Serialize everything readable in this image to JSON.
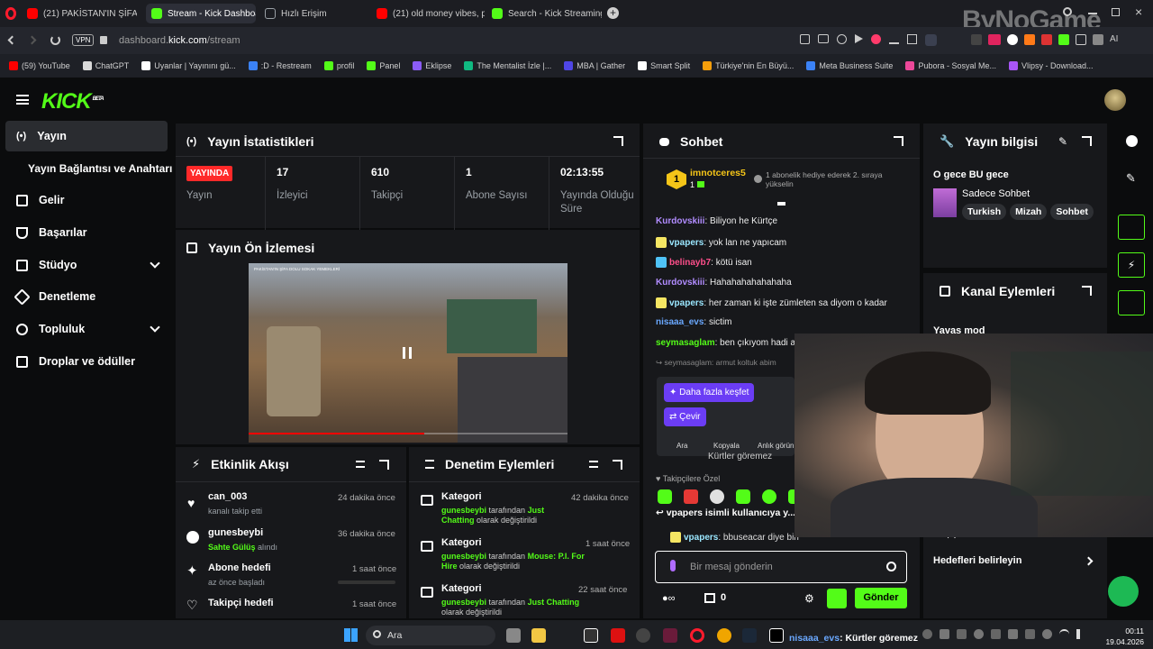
{
  "browser": {
    "tabs": [
      {
        "label": "(21) PAKİSTAN'IN ŞİFA DO",
        "color": "#ff0000",
        "active": false
      },
      {
        "label": "Stream - Kick Dashboard",
        "color": "#53fc18",
        "active": true
      },
      {
        "label": "Hızlı Erişim",
        "color": "#9aa0a6",
        "active": false
      },
      {
        "label": "(21) old money vibes, play",
        "color": "#ff0000",
        "active": false
      },
      {
        "label": "Search - Kick Streaming",
        "color": "#53fc18",
        "active": false
      }
    ],
    "vpn": "VPN",
    "url_prefix": "dashboard.",
    "url_domain": "kick.com",
    "url_path": "/stream",
    "bookmarks": [
      {
        "label": "(59) YouTube",
        "color": "#ff0000"
      },
      {
        "label": "ChatGPT",
        "color": "#d9d9d9"
      },
      {
        "label": "Uyanlar | Yayınını gü...",
        "color": "#ffffff"
      },
      {
        "label": ":D - Restream",
        "color": "#3b82f6"
      },
      {
        "label": "profil",
        "color": "#53fc18"
      },
      {
        "label": "Panel",
        "color": "#53fc18"
      },
      {
        "label": "Eklipse",
        "color": "#8b5cf6"
      },
      {
        "label": "The Mentalist İzle |...",
        "color": "#10b981"
      },
      {
        "label": "MBA | Gather",
        "color": "#4f46e5"
      },
      {
        "label": "Smart Split",
        "color": "#ffffff"
      },
      {
        "label": "Türkiye'nin En Büyü...",
        "color": "#f59e0b"
      },
      {
        "label": "Meta Business Suite",
        "color": "#3b82f6"
      },
      {
        "label": "Pubora - Sosyal Me...",
        "color": "#ec4899"
      },
      {
        "label": "Vlipsy - Download...",
        "color": "#a855f7"
      }
    ],
    "watermark": "ByNoGame"
  },
  "kick": {
    "logo": "KICK",
    "logo_sup": "BETA",
    "accent": "#53fc18"
  },
  "sidebar": {
    "items": [
      {
        "label": "Yayın",
        "active": true
      },
      {
        "label": "Yayın Bağlantısı ve Anahtarı"
      },
      {
        "label": "Gelir"
      },
      {
        "label": "Başarılar"
      },
      {
        "label": "Stüdyo",
        "chevron": true
      },
      {
        "label": "Denetleme"
      },
      {
        "label": "Topluluk",
        "chevron": true
      },
      {
        "label": "Droplar ve ödüller"
      }
    ]
  },
  "stats": {
    "title": "Yayın İstatistikleri",
    "live_badge": "YAYINDA",
    "items": [
      {
        "value": "",
        "label": "Yayın"
      },
      {
        "value": "17",
        "label": "İzleyici"
      },
      {
        "value": "610",
        "label": "Takipçi"
      },
      {
        "value": "1",
        "label": "Abone Sayısı"
      },
      {
        "value": "02:13:55",
        "label": "Yayında Olduğu Süre"
      }
    ]
  },
  "preview": {
    "title": "Yayın Ön İzlemesi",
    "caption": "PAKİSTAN'IN ŞİFA DOLU SOKAK YEMEKLERİ"
  },
  "activity": {
    "title": "Etkinlik Akışı",
    "items": [
      {
        "name": "can_003",
        "sub": "kanalı takip etti",
        "time": "24 dakika önce"
      },
      {
        "name": "gunesbeybi",
        "sub_hl": "Sahte Gülüş",
        "sub": "alındı",
        "time": "36 dakika önce"
      },
      {
        "name": "Abone hedefi",
        "sub": "az önce başladı",
        "time": "1 saat önce"
      },
      {
        "name": "Takipçi hedefi",
        "sub": "",
        "time": "1 saat önce"
      }
    ]
  },
  "moderation": {
    "title": "Denetim Eylemleri",
    "items": [
      {
        "name": "Kategori",
        "user": "gunesbeybi",
        "mid": "tarafından",
        "value": "Just Chatting",
        "end": "olarak değiştirildi",
        "time": "42 dakika önce"
      },
      {
        "name": "Kategori",
        "user": "gunesbeybi",
        "mid": "tarafından",
        "value": "Mouse: P.I. For Hire",
        "end": "olarak değiştirildi",
        "time": "1 saat önce"
      },
      {
        "name": "Kategori",
        "user": "gunesbeybi",
        "mid": "tarafından",
        "value": "Just Chatting",
        "end": "olarak değiştirildi",
        "time": "22 saat önce"
      }
    ]
  },
  "chat": {
    "title": "Sohbet",
    "pinned_user": "imnotceres5",
    "pinned_count": "1",
    "pinned_text": "1 abonelik hediye ederek 2. sıraya yükselin",
    "messages": [
      {
        "user": "Kurdovskiii",
        "color": "#b18cff",
        "text": "Biliyon he Kürtçe",
        "badge": ""
      },
      {
        "user": "vpapers",
        "color": "#9be7ff",
        "text": "yok lan ne yapıcam",
        "badge": "#f5e663"
      },
      {
        "user": "belinayb7",
        "color": "#ff4f8b",
        "text": "kötü isan",
        "badge": "#4fc3f7"
      },
      {
        "user": "Kurdovskiii",
        "color": "#b18cff",
        "text": "Hahahahahahahaha",
        "badge": ""
      },
      {
        "user": "vpapers",
        "color": "#9be7ff",
        "text": "her zaman ki işte zümleten sa diyom o kadar",
        "badge": "#f5e663"
      },
      {
        "user": "nisaaa_evs",
        "color": "#6aa8ff",
        "text": "sictim",
        "badge": ""
      },
      {
        "user": "seymasaglam",
        "color": "#53fc18",
        "text": "ben çıkıyom hadi ay...",
        "badge": ""
      }
    ],
    "reply_to": "seymasaglam: armut koltuk abim",
    "popup": {
      "explore": "Daha fazla keşfet",
      "translate": "Çevir",
      "search": "Ara",
      "copy": "Kopyala",
      "instant": "Anlık görün"
    },
    "partial_msg": "Kürtler göremez",
    "followers_only": "Takipçilere Özel",
    "reply_banner": "vpapers isimli kullanıcıya y...",
    "reply_user": "vpapers",
    "reply_text": "bbuseacar diye biri",
    "input_placeholder": "Bir mesaj gönderin",
    "points": "0",
    "send": "Gönder"
  },
  "stream_info": {
    "title": "Yayın bilgisi",
    "stream_title": "O gece BU gece",
    "category": "Sadece Sohbet",
    "tags": [
      "Turkish",
      "Mizah",
      "Sohbet"
    ]
  },
  "channel_actions": {
    "title": "Kanal Eylemleri",
    "slow_mode": "Yavaş mod",
    "goals": "Hedefleri belirleyin",
    "hidden_row": "takipçi hedefi"
  },
  "overlay_caption": {
    "user": "nisaaa_evs",
    "text": ": Kürtler göremez"
  },
  "taskbar": {
    "search": "Ara",
    "time": "00:11",
    "date": "19.04.2026"
  }
}
